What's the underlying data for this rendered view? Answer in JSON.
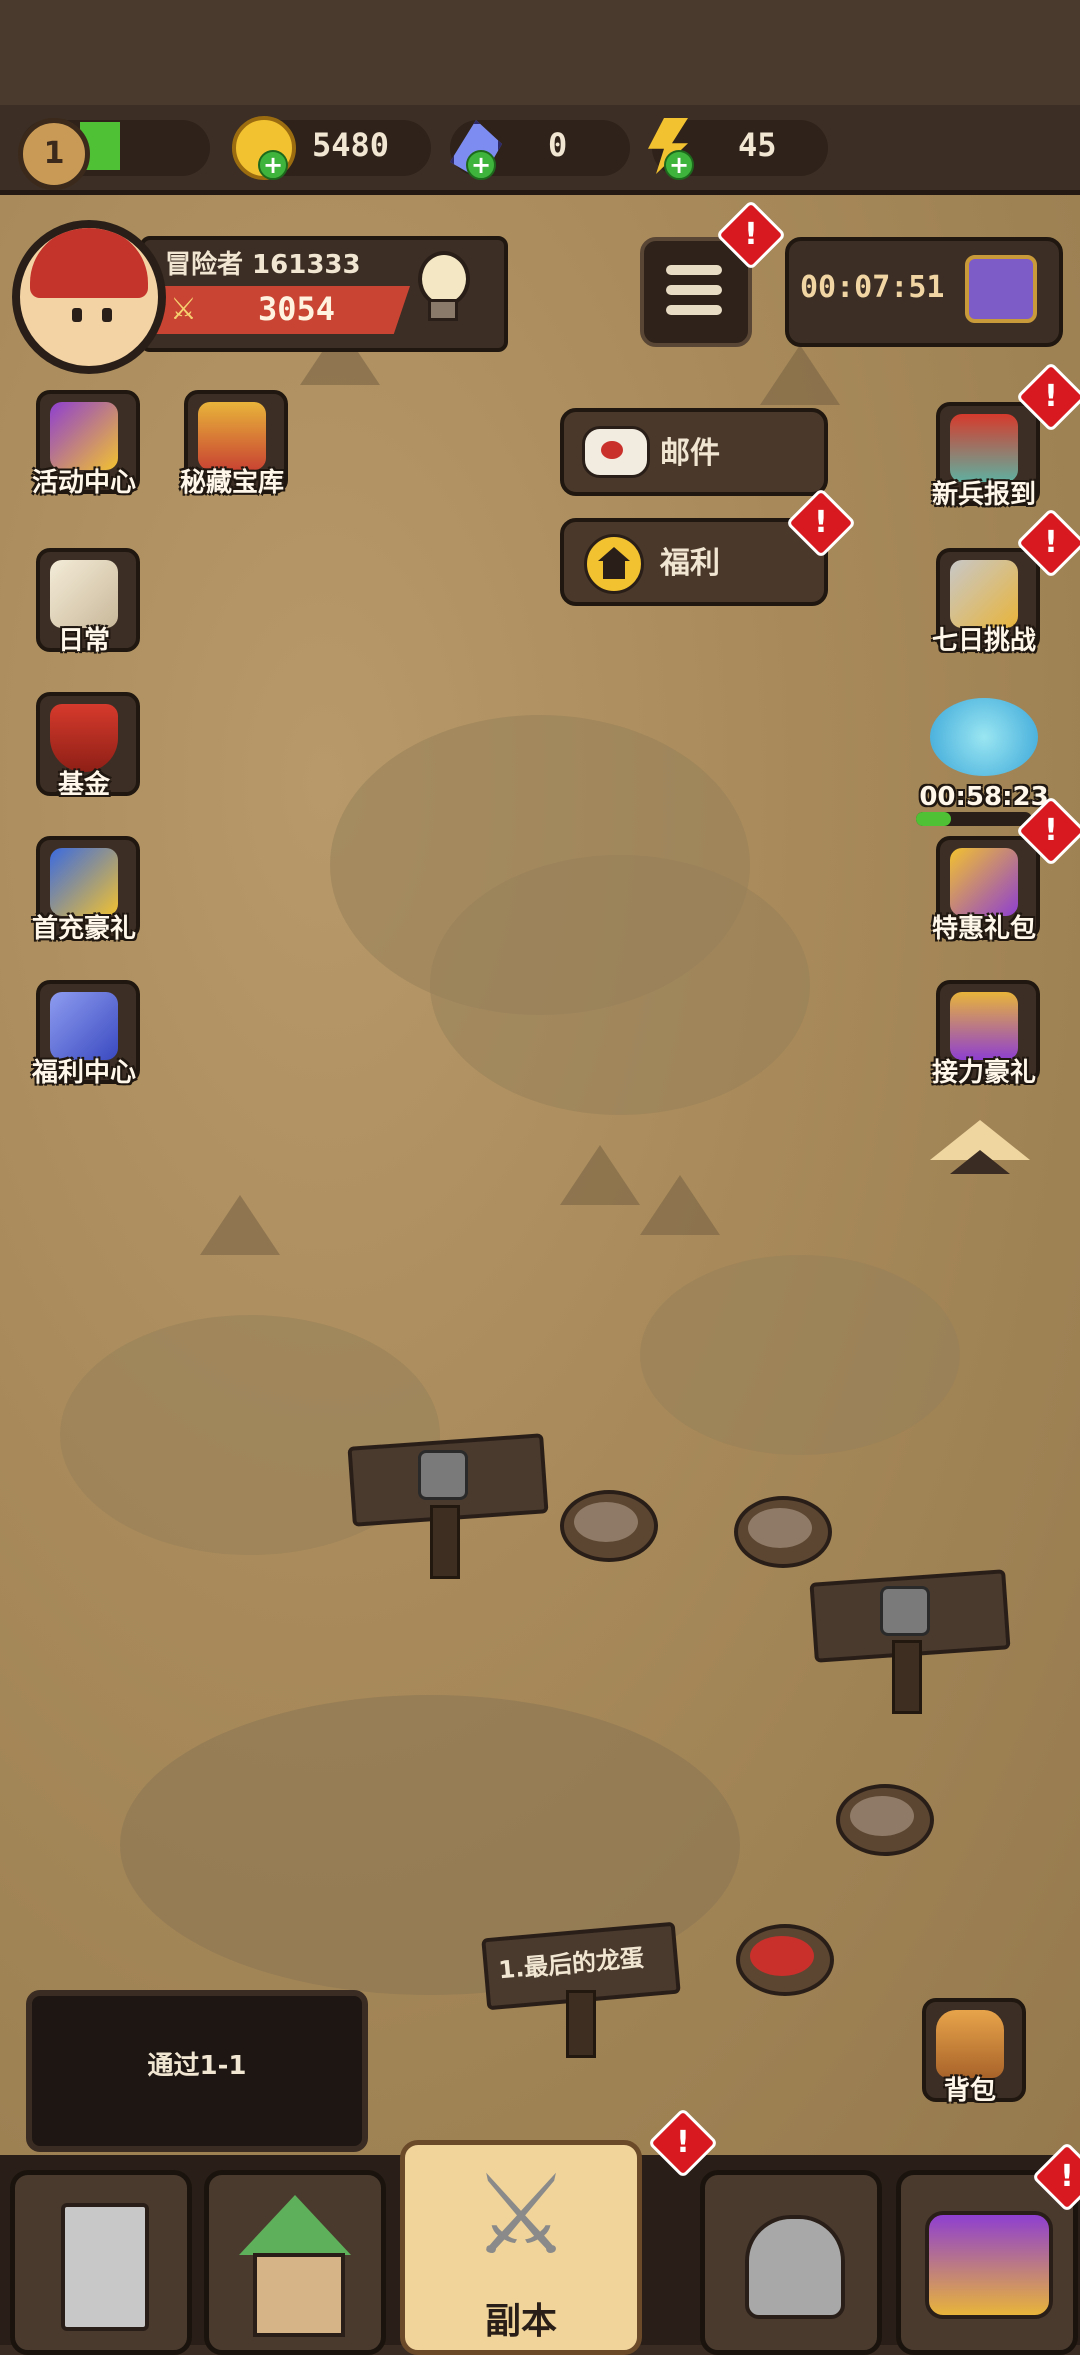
{
  "resources": {
    "level": "1",
    "gold": "5480",
    "gems": "0",
    "energy": "45"
  },
  "player": {
    "name": "冒险者 161333",
    "power": "3054"
  },
  "timer": "00:07:51",
  "float_buttons": {
    "mail": "邮件",
    "welfare": "福利"
  },
  "left_icons": [
    {
      "label": "活动中心"
    },
    {
      "label": "秘藏宝库"
    },
    {
      "label": "日常"
    },
    {
      "label": "基金"
    },
    {
      "label": "首充豪礼"
    },
    {
      "label": "福利中心"
    }
  ],
  "right_icons": [
    {
      "label": "新兵报到"
    },
    {
      "label": "七日挑战"
    },
    {
      "label": "00:58:23"
    },
    {
      "label": "特惠礼包"
    },
    {
      "label": "接力豪礼"
    }
  ],
  "badge_symbol": "!",
  "stage_sign": "1.最后的龙蛋",
  "quest": "通过1-1",
  "bag_label": "背包",
  "bottom_nav": {
    "active_label": "副本"
  },
  "colors": {
    "power_bar": "#c94432",
    "notification_badge": "#d8191f",
    "level_progress": "#4ec234",
    "active_nav": "#f0d49a"
  }
}
